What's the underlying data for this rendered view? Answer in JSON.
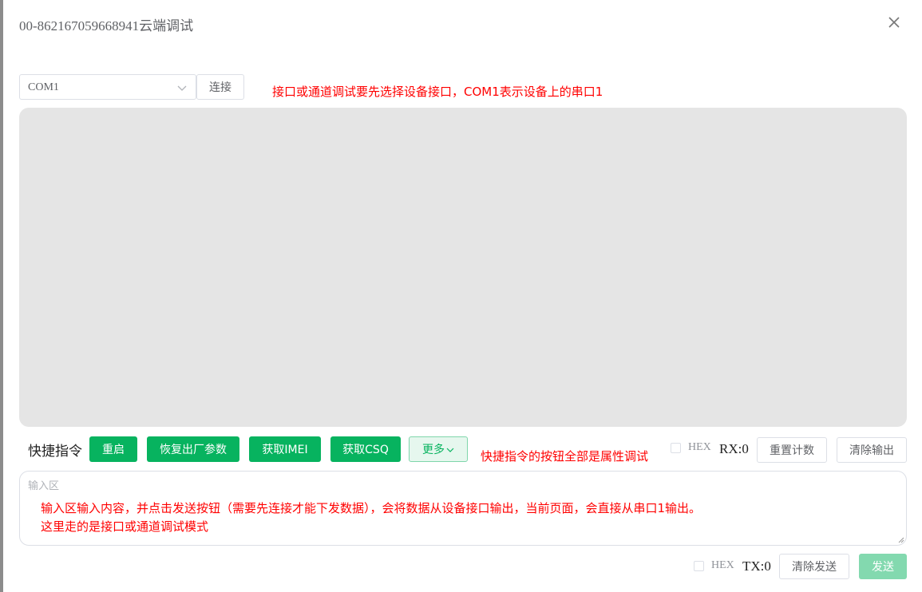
{
  "dialog": {
    "title": "00-862167059668941云端调试"
  },
  "port": {
    "selected": "COM1"
  },
  "buttons": {
    "connect": "连接"
  },
  "annotations": {
    "port_note": "接口或通道调试要先选择设备接口，COM1表示设备上的串口1",
    "shortcut_note": "快捷指令的按钮全部是属性调试",
    "input_note_line1": "输入区输入内容，并点击发送按钮（需要先连接才能下发数据），会将数据从设备接口输出，当前页面，会直接从串口1输出。",
    "input_note_line2": "这里走的是接口或通道调试模式"
  },
  "shortcuts": {
    "label": "快捷指令",
    "restart": "重启",
    "factory_reset": "恢复出厂参数",
    "get_imei": "获取IMEI",
    "get_csq": "获取CSQ",
    "more": "更多"
  },
  "receive": {
    "hex_label": "HEX",
    "counter": "RX:0",
    "reset_count": "重置计数",
    "clear_output": "清除输出"
  },
  "input": {
    "placeholder": "输入区"
  },
  "send": {
    "hex_label": "HEX",
    "counter": "TX:0",
    "clear_send": "清除发送",
    "send": "发送"
  },
  "colors": {
    "primary_green": "#07b35f",
    "disabled_green": "#83d9af",
    "annotation_red": "#ff0000",
    "output_bg": "#e5e5e5"
  },
  "icons": {
    "close": "close-icon",
    "dropdown": "chevron-down-icon",
    "more_caret": "chevron-down-icon"
  }
}
